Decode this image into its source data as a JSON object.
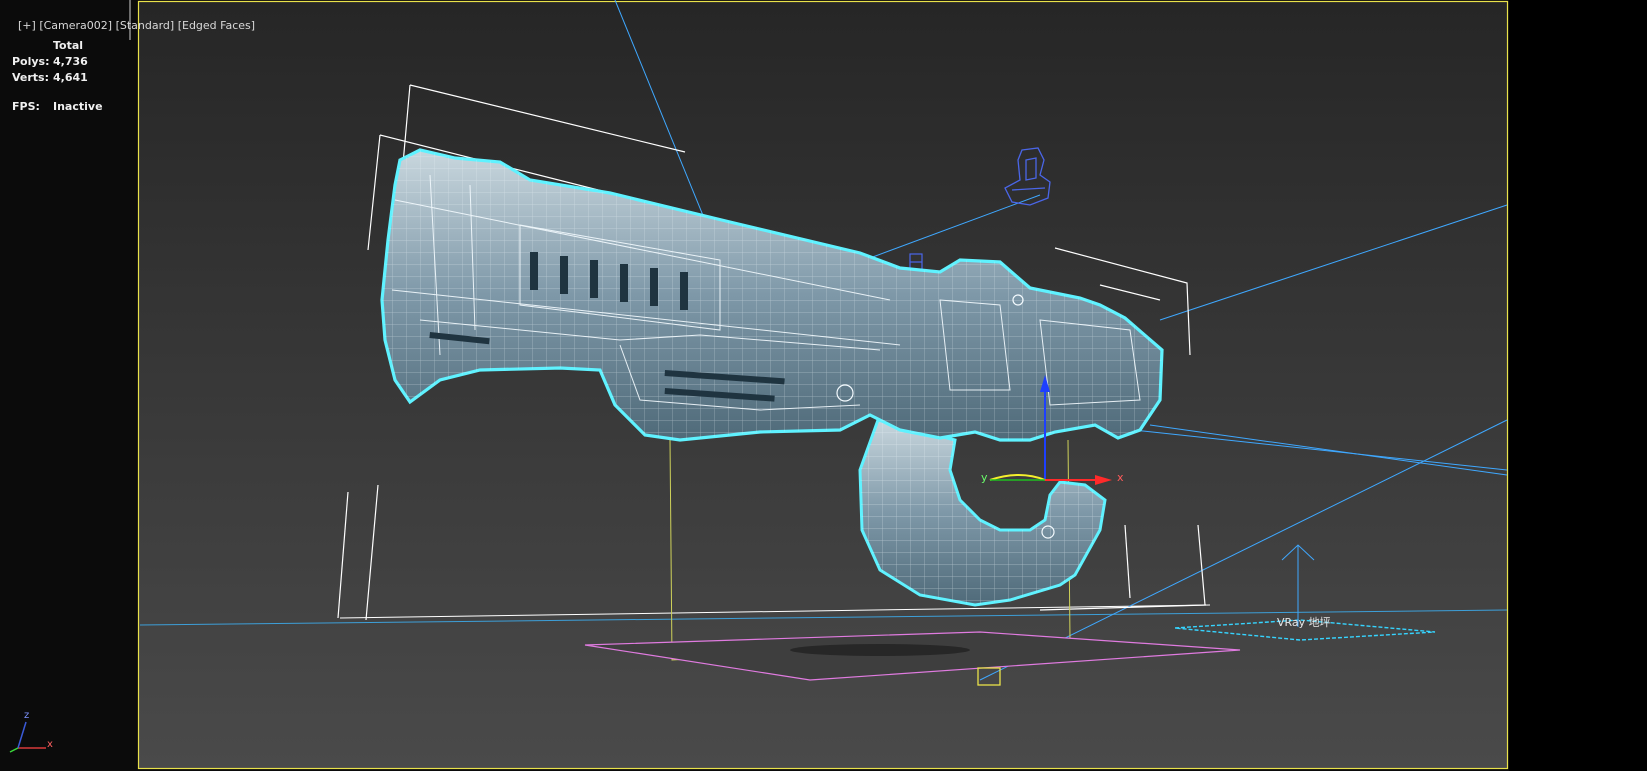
{
  "viewport_label": {
    "plus": "[+]",
    "camera": "[Camera002]",
    "shading": "[Standard]",
    "mode": "[Edged Faces]"
  },
  "stats": {
    "total_label": "Total",
    "polys_label": "Polys:",
    "polys_value": "4,736",
    "verts_label": "Verts:",
    "verts_value": "4,641",
    "fps_label": "FPS:",
    "fps_value": "Inactive"
  },
  "objects": {
    "vray_plane_label": "VRay 地坪"
  },
  "gizmo": {
    "x_label": "x",
    "y_label": "y",
    "z_label": "z"
  },
  "colors": {
    "viewport_bg_top": "#2a2a2a",
    "viewport_bg_bottom": "#4c4c4c",
    "selection_outline": "#5ff2ff",
    "viewport_border": "#f2e94e",
    "light_line": "#3fa8ff",
    "bbox_white": "#ffffff",
    "plane_magenta": "#e07be0",
    "ground_cyan": "#36d4ff"
  }
}
